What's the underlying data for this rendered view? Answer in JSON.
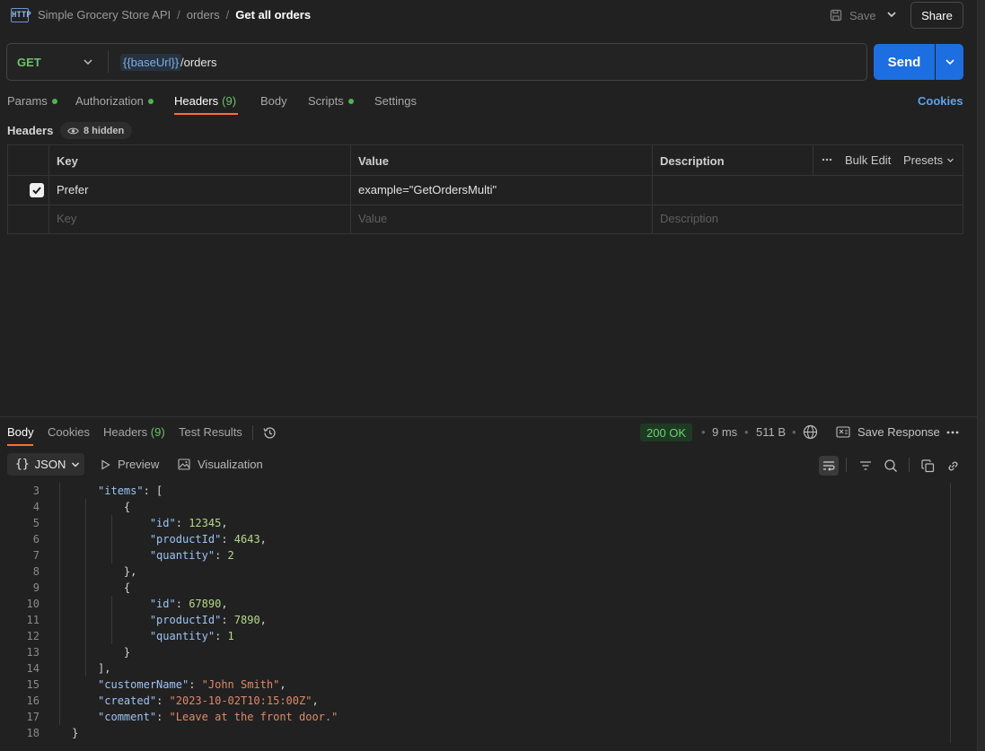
{
  "breadcrumb": {
    "items": [
      "Simple Grocery Store API",
      "orders",
      "Get all orders"
    ],
    "logo": "HTTP"
  },
  "toolbar": {
    "save_label": "Save",
    "share_label": "Share"
  },
  "request": {
    "method": "GET",
    "url_var": "{{baseUrl}}",
    "url_path": "/orders",
    "send_label": "Send"
  },
  "request_tabs": [
    {
      "label": "Params",
      "dot": true
    },
    {
      "label": "Authorization",
      "dot": true
    },
    {
      "label": "Headers",
      "count": "(9)",
      "active": true
    },
    {
      "label": "Body"
    },
    {
      "label": "Scripts",
      "dot": true
    },
    {
      "label": "Settings"
    }
  ],
  "cookies_link": "Cookies",
  "headers_section": {
    "title": "Headers",
    "hidden_label": "8 hidden"
  },
  "headers_table": {
    "columns": [
      "Key",
      "Value",
      "Description"
    ],
    "bulk_edit": "Bulk Edit",
    "presets": "Presets",
    "rows": [
      {
        "checked": true,
        "key": "Prefer",
        "value": "example=\"GetOrdersMulti\"",
        "description": ""
      }
    ],
    "placeholders": {
      "key": "Key",
      "value": "Value",
      "description": "Description"
    }
  },
  "response_tabs": [
    {
      "label": "Body",
      "active": true
    },
    {
      "label": "Cookies"
    },
    {
      "label": "Headers",
      "count": "(9)"
    },
    {
      "label": "Test Results"
    }
  ],
  "response_meta": {
    "status": "200 OK",
    "time": "9 ms",
    "size": "511 B",
    "save_response": "Save Response"
  },
  "response_tools": {
    "format": "JSON",
    "preview": "Preview",
    "visualization": "Visualization"
  },
  "code_lines": [
    {
      "n": "3"
    },
    {
      "n": "4"
    },
    {
      "n": "5"
    },
    {
      "n": "6"
    },
    {
      "n": "7"
    },
    {
      "n": "8"
    },
    {
      "n": "9"
    },
    {
      "n": "10"
    },
    {
      "n": "11"
    },
    {
      "n": "12"
    },
    {
      "n": "13"
    },
    {
      "n": "14"
    },
    {
      "n": "15"
    },
    {
      "n": "16"
    },
    {
      "n": "17"
    },
    {
      "n": "18"
    }
  ],
  "code_tokens": {
    "items": "\"items\"",
    "id": "\"id\"",
    "productId": "\"productId\"",
    "quantity": "\"quantity\"",
    "customerName": "\"customerName\"",
    "created": "\"created\"",
    "comment": "\"comment\"",
    "v_id1": "12345",
    "v_pid1": "4643",
    "v_q1": "2",
    "v_id2": "67890",
    "v_pid2": "7890",
    "v_q2": "1",
    "v_name": "\"John Smith\"",
    "v_created": "\"2023-10-02T10:15:00Z\"",
    "v_comment": "\"Leave at the front door.\""
  },
  "colors": {
    "accent": "#ff6c37",
    "send": "#1d6ee0",
    "success": "#6cc36c",
    "link": "#5aa4f0"
  }
}
